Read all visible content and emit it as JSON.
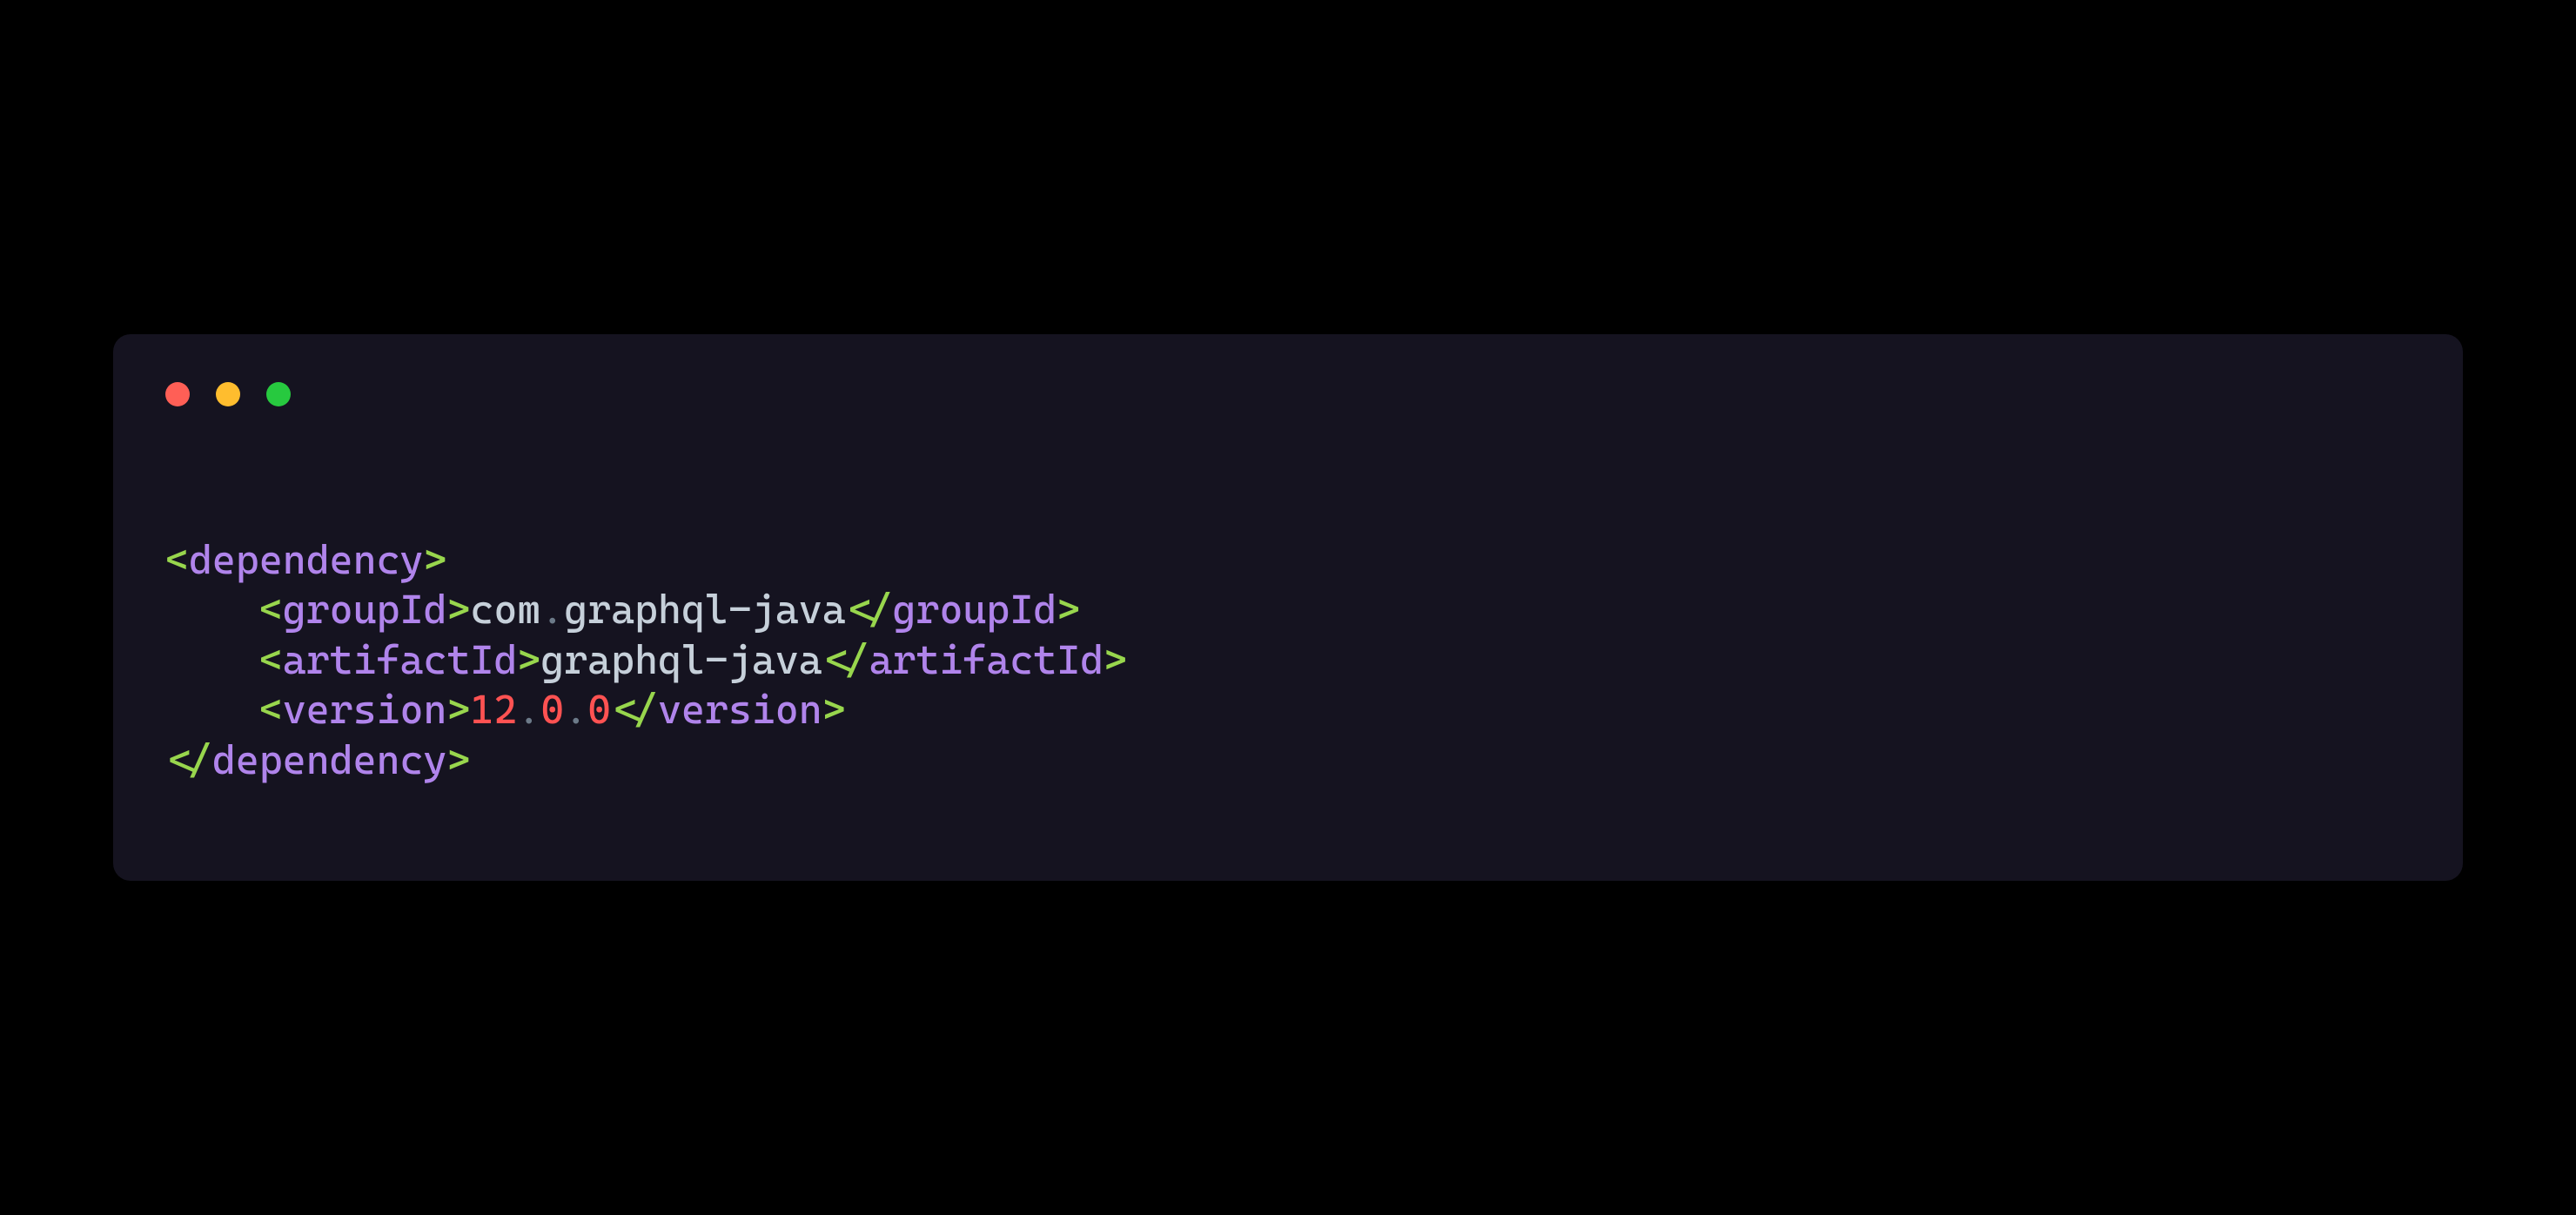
{
  "window": {
    "dots": {
      "red": "close",
      "yellow": "minimize",
      "green": "zoom"
    }
  },
  "code": {
    "indent": "    ",
    "open_bracket": "<",
    "close_bracket": ">",
    "open_slash_bracket": "</",
    "tags": {
      "dependency": "dependency",
      "groupId": "groupId",
      "artifactId": "artifactId",
      "version": "version"
    },
    "values": {
      "groupId_pre": "com",
      "groupId_dot": ".",
      "groupId_post": "graphql-java",
      "artifactId": "graphql-java",
      "version_major": "12",
      "version_dot1": ".",
      "version_minor": "0",
      "version_dot2": ".",
      "version_patch": "0"
    }
  }
}
